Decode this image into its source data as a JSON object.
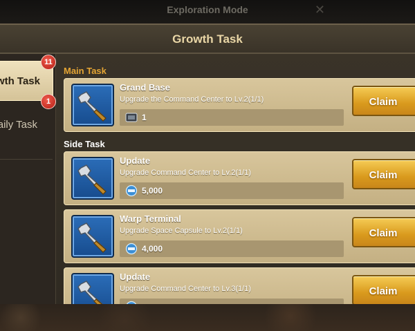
{
  "background": {
    "mode_title": "Exploration Mode",
    "close_glyph": "✕"
  },
  "header": {
    "title": "Growth Task"
  },
  "sidebar": {
    "tabs": [
      {
        "label": "Growth Task",
        "badge": "11",
        "active": true
      },
      {
        "label": "Daily Task",
        "badge": "1",
        "active": false
      }
    ]
  },
  "sections": {
    "main_label": "Main Task",
    "side_label": "Side Task"
  },
  "colors": {
    "main_label": "#e5a534",
    "side_label": "#ffffff",
    "claim_button": "#e3a526"
  },
  "tasks": [
    {
      "title": "Grand Base",
      "desc": "Upgrade the Command Center to Lv.2(1/1)",
      "reward_icon": "ticket-icon",
      "reward": "1",
      "button": "Claim"
    },
    {
      "title": "Update",
      "desc": "Upgrade Command Center to Lv.2(1/1)",
      "reward_icon": "exp-icon",
      "reward": "5,000",
      "button": "Claim"
    },
    {
      "title": "Warp Terminal",
      "desc": "Upgrade Space Capsule to Lv.2(1/1)",
      "reward_icon": "exp-icon",
      "reward": "4,000",
      "button": "Claim"
    },
    {
      "title": "Update",
      "desc": "Upgrade Command Center to Lv.3(1/1)",
      "reward_icon": "exp-icon",
      "reward": "",
      "button": "Claim"
    }
  ]
}
